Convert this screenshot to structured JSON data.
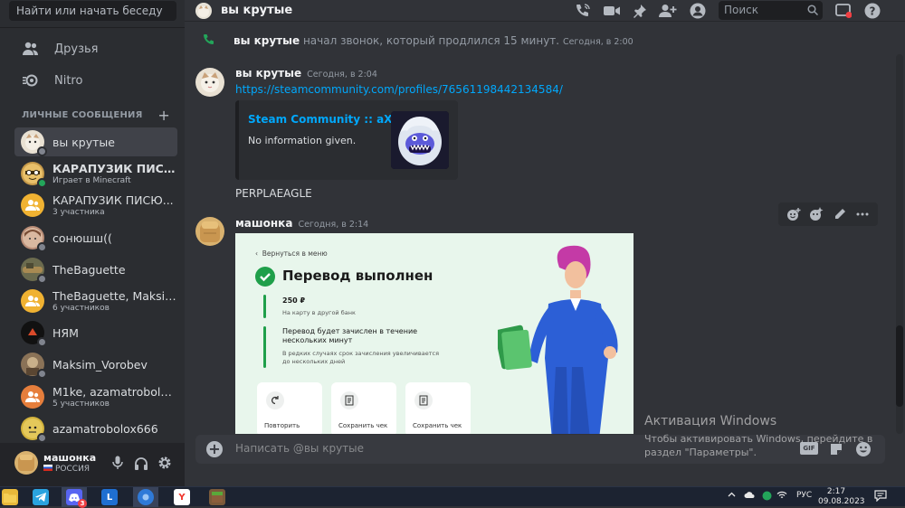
{
  "sidebar": {
    "search_placeholder": "Найти или начать беседу",
    "nav": [
      {
        "label": "Друзья",
        "icon": "friends-icon"
      },
      {
        "label": "Nitro",
        "icon": "nitro-icon"
      }
    ],
    "dm_header": "ЛИЧНЫЕ СООБЩЕНИЯ",
    "dms": [
      {
        "name": "вы крутые",
        "sub": "",
        "active": true,
        "avatar_color": "#e9e1d3"
      },
      {
        "name": "КАРАПУЗИК ПИСЮ...",
        "sub": "Играет в Minecraft",
        "online": true,
        "avatar_color": "#c79a4a"
      },
      {
        "name": "КАРАПУЗИК ПИСЮ...",
        "sub": "3 участника",
        "avatar_color": "#f0b232"
      },
      {
        "name": "сонюшш((",
        "sub": "",
        "avatar_color": "#b98d77"
      },
      {
        "name": "TheBaguette",
        "sub": "",
        "avatar_color": "#6b6b4e"
      },
      {
        "name": "TheBaguette, Maksim...",
        "sub": "6 участников",
        "avatar_color": "#f0b232"
      },
      {
        "name": "НЯМ",
        "sub": "",
        "avatar_color": "#111111"
      },
      {
        "name": "Maksim_Vorobev",
        "sub": "",
        "avatar_color": "#8a7257"
      },
      {
        "name": "M1ke, azamatrobolox...",
        "sub": "5 участников",
        "avatar_color": "#e67e3c"
      },
      {
        "name": "azamatrobolox666",
        "sub": "",
        "avatar_color": "#d2b23c"
      }
    ],
    "user": {
      "name": "машонка",
      "status": "РОССИЯ"
    }
  },
  "header": {
    "title": "вы крутые",
    "search_placeholder": "Поиск"
  },
  "messages": {
    "call": {
      "author": "вы крутые",
      "text": " начал звонок, который продлился 15 минут.",
      "time": "Сегодня, в 2:00"
    },
    "msg1": {
      "author": "вы крутые",
      "time": "Сегодня, в 2:04",
      "link": "https://steamcommunity.com/profiles/76561198442134584/",
      "embed_title": "Steam Community :: aXEL",
      "embed_desc": "No information given.",
      "text": "PERPLAEAGLE"
    },
    "msg2": {
      "author": "машонка",
      "time": "Сегодня, в 2:14",
      "image": {
        "back": "Вернуться в меню",
        "title": "Перевод выполнен",
        "amount": "250 ₽",
        "amount_sub": "На карту в другой банк",
        "note_1": "Перевод будет зачислен в течение",
        "note_2": "нескольких минут",
        "note_sub_1": "В редких случаях срок зачисления увеличивается",
        "note_sub_2": "до нескольких дней",
        "cards": [
          "Повторить",
          "Сохранить чек",
          "Сохранить чек"
        ]
      }
    }
  },
  "input": {
    "placeholder": "Написать @вы крутые",
    "gif_label": "GIF"
  },
  "watermark": {
    "title": "Активация Windows",
    "text": "Чтобы активировать Windows, перейдите в раздел \"Параметры\"."
  },
  "taskbar": {
    "lang": "РУС",
    "time": "2:17",
    "date": "09.08.2023",
    "discord_badge": "3",
    "app_l": "L",
    "app_y": "Y"
  },
  "colors": {
    "accent": "#5865f2",
    "link": "#00a8fc",
    "online": "#23a55a",
    "bank_green": "#1f9f4a"
  }
}
